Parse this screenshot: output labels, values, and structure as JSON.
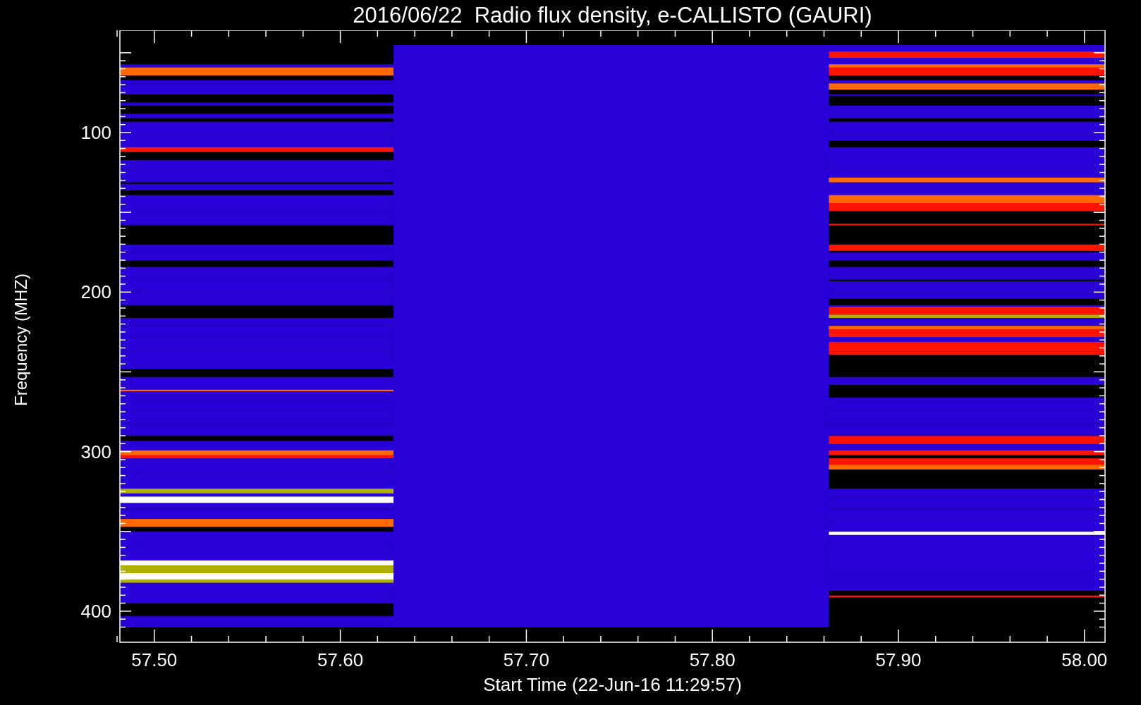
{
  "title": "2016/06/22  Radio flux density, e-CALLISTO (GAURI)",
  "y_axis": {
    "label": "Frequency (MHZ)",
    "ticks": [
      "100",
      "200",
      "300",
      "400"
    ]
  },
  "x_axis": {
    "label": "Start Time (22-Jun-16 11:29:57)",
    "ticks": [
      "57.50",
      "57.60",
      "57.70",
      "57.80",
      "57.90",
      "58.00"
    ]
  }
}
